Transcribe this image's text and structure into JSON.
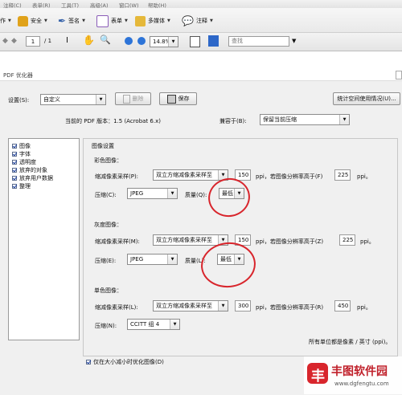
{
  "menu": [
    "注释(C)",
    "表单(R)",
    "工具(T)",
    "高级(A)",
    "窗口(W)",
    "帮助(H)"
  ],
  "toolbar": {
    "create_label": "作",
    "security_label": "安全",
    "sign_label": "签名",
    "forms_label": "表单",
    "multimedia_label": "多媒体",
    "comment_label": "注释"
  },
  "nav": {
    "page_value": "1",
    "page_total": "/ 1",
    "zoom_value": "14.8%",
    "find_placeholder": "查找"
  },
  "dialog": {
    "title": "PDF 优化器",
    "settings_label": "设置(S):",
    "settings_value": "自定义",
    "delete_label": "删除",
    "save_label": "保存",
    "audit_label": "统计空间使用情况(U)...",
    "current_version": "当前的 PDF 版本：1.5 (Acrobat 6.x)",
    "compat_label": "兼容于(B):",
    "compat_value": "保留当前压缩",
    "categories": [
      "图像",
      "字体",
      "透明度",
      "放弃的对象",
      "放弃用户数据",
      "整理"
    ],
    "section_title": "图像设置",
    "color": {
      "heading": "彩色图像：",
      "downsample_label": "缩减像素采样(P):",
      "downsample_value": "双立方缩减像素采样至",
      "ppi_value": "150",
      "ppi_text": "ppi，若图像分辨率高于(F)",
      "above_value": "225",
      "ppi_unit": "ppi。",
      "compression_label": "压缩(C):",
      "compression_value": "JPEG",
      "quality_label": "质量(Q):",
      "quality_value": "最低"
    },
    "gray": {
      "heading": "灰度图像：",
      "downsample_label": "缩减像素采样(M):",
      "downsample_value": "双立方缩减像素采样至",
      "ppi_value": "150",
      "ppi_text": "ppi，若图像分辨率高于(Z)",
      "above_value": "225",
      "ppi_unit": "ppi。",
      "compression_label": "压缩(E):",
      "compression_value": "JPEG",
      "quality_label": "质量(L):",
      "quality_value": "最低"
    },
    "mono": {
      "heading": "单色图像：",
      "downsample_label": "缩减像素采样(L):",
      "downsample_value": "双立方缩减像素采样至",
      "ppi_value": "300",
      "ppi_text": "ppi，若图像分辨率高于(R)",
      "above_value": "450",
      "ppi_unit": "ppi。",
      "compression_label": "压缩(N):",
      "compression_value": "CCITT 组 4"
    },
    "footnote": "所有单位都是像素 / 英寸 (ppi)。",
    "optimize_only_label": "仅在大小减小时优化图像(D)"
  },
  "watermark": {
    "brand": "丰图软件园",
    "url": "www.dgfengtu.com"
  },
  "colors": {
    "annotation_red": "#d8252c",
    "check_blue": "#1b3fa0",
    "dialog_bg": "#f0f0f0"
  }
}
